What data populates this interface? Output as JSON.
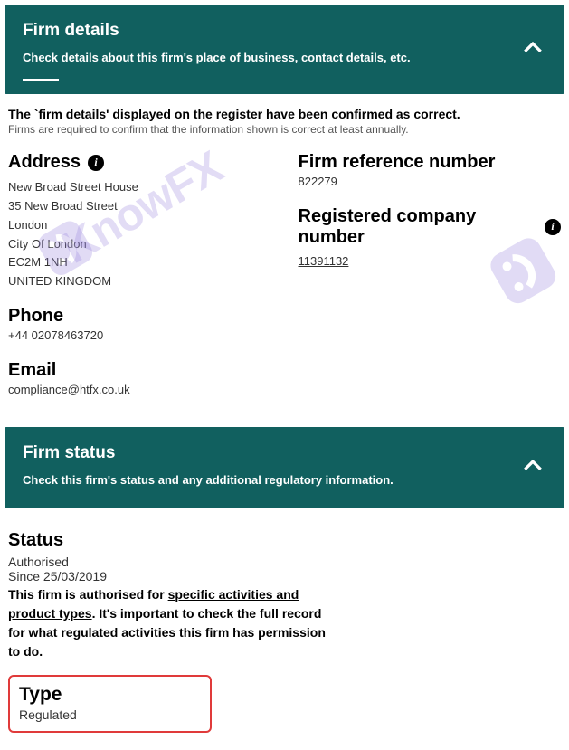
{
  "panel1": {
    "title": "Firm details",
    "desc": "Check details about this firm's place of business, contact details, etc."
  },
  "confirm": {
    "bold": "The `firm details' displayed on the register have been confirmed as correct.",
    "sub": "Firms are required to confirm that the information shown is correct at least annually."
  },
  "address": {
    "heading": "Address",
    "l1": "New Broad Street House",
    "l2": "35 New Broad Street",
    "l3": "London",
    "l4": "City Of London",
    "l5": "EC2M 1NH",
    "l6": "UNITED KINGDOM"
  },
  "phone": {
    "heading": "Phone",
    "value": "+44 02078463720"
  },
  "email": {
    "heading": "Email",
    "value": "compliance@htfx.co.uk"
  },
  "frn": {
    "heading": "Firm reference number",
    "value": "822279"
  },
  "rcn": {
    "heading": "Registered company number",
    "value": "11391132"
  },
  "panel2": {
    "title": "Firm status",
    "desc": "Check this firm's status and any additional regulatory information."
  },
  "status": {
    "heading": "Status",
    "value": "Authorised",
    "since": "Since 25/03/2019",
    "desc_pre": "This firm is authorised for ",
    "desc_link": "specific activities and product types",
    "desc_post": ". It's important to check the full record for what regulated activities this firm has permission to do."
  },
  "type": {
    "heading": "Type",
    "value": "Regulated"
  },
  "watermark": "KnowFX",
  "watermark2": "K"
}
